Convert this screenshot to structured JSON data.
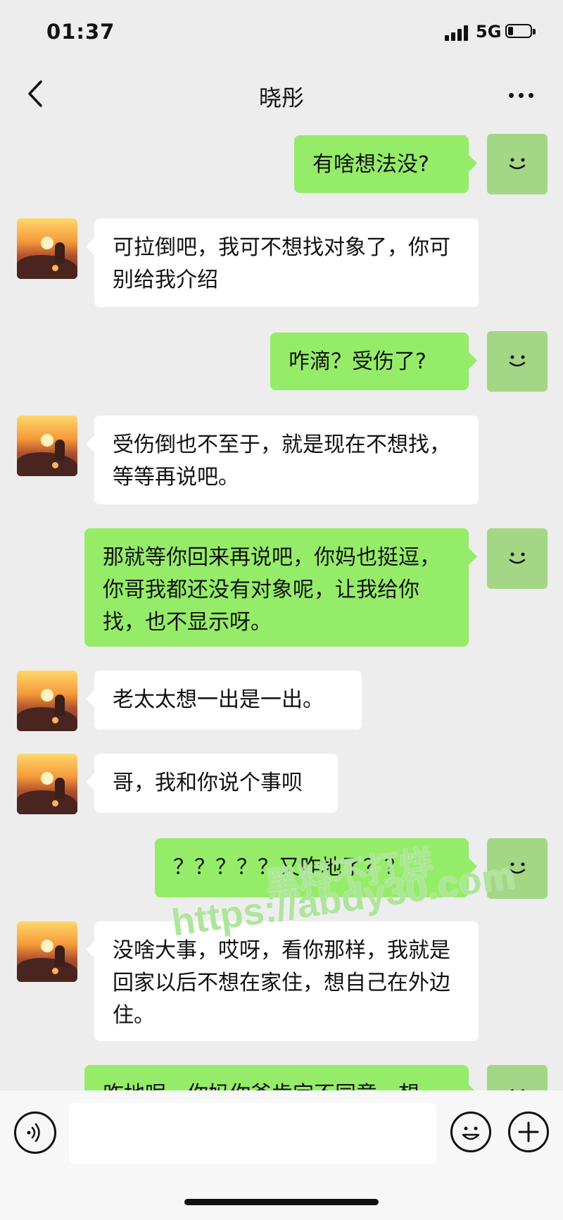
{
  "status": {
    "time": "01:37",
    "network": "5G"
  },
  "header": {
    "contact_name": "晓彤"
  },
  "messages": [
    {
      "from": "me",
      "text": "有啥想法没?"
    },
    {
      "from": "other",
      "text": "可拉倒吧，我可不想找对象了，你可别给我介绍"
    },
    {
      "from": "me",
      "text": "咋滴？受伤了?"
    },
    {
      "from": "other",
      "text": "受伤倒也不至于，就是现在不想找，等等再说吧。"
    },
    {
      "from": "me",
      "text": "那就等你回来再说吧，你妈也挺逗，你哥我都还没有对象呢，让我给你找，也不显示呀。"
    },
    {
      "from": "other",
      "text": "老太太想一出是一出。"
    },
    {
      "from": "other",
      "text": "哥，我和你说个事呗"
    },
    {
      "from": "me",
      "text": "？？？？？又咋地了？？"
    },
    {
      "from": "other",
      "text": "没啥大事，哎呀，看你那样，我就是回家以后不想在家住，想自己在外边住。"
    },
    {
      "from": "me",
      "text": "咋地呢，你妈你爸肯定不同意，想"
    }
  ],
  "input": {
    "placeholder": ""
  },
  "watermark": {
    "line1": "黑料不打烊",
    "line2": "https://abdy30.com"
  },
  "colors": {
    "background": "#ededed",
    "my_bubble": "#95ec69",
    "other_bubble": "#ffffff"
  },
  "icons": [
    "back-icon",
    "more-icon",
    "voice-icon",
    "emoji-icon",
    "plus-icon",
    "signal-icon",
    "battery-icon"
  ]
}
